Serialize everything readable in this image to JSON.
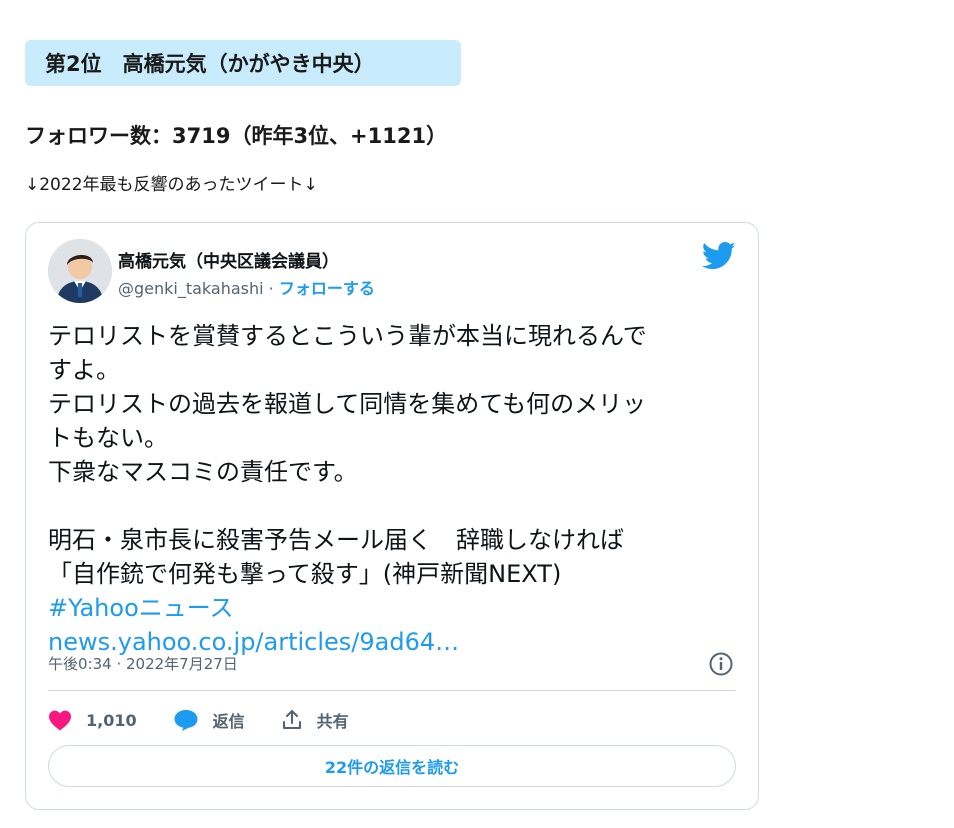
{
  "rank": {
    "label": "第2位　高橋元気（かがやき中央）"
  },
  "followers": {
    "text": "フォロワー数：3719（昨年3位、+1121）"
  },
  "note": {
    "text": "↓2022年最も反響のあったツイート↓"
  },
  "tweet": {
    "author_name": "高橋元気（中央区議会議員）",
    "handle": "@genki_takahashi",
    "separator": " · ",
    "follow_label": "フォローする",
    "body": {
      "line1": "テロリストを賞賛するとこういう輩が本当に現れるんで",
      "line2": "すよ。",
      "line3": "テロリストの過去を報道して同情を集めても何のメリッ",
      "line4": "トもない。",
      "line5": "下衆なマスコミの責任です。",
      "line6": "明石・泉市長に殺害予告メール届く　辞職しなければ",
      "line7": "「自作銃で何発も撃って殺す」(神戸新聞NEXT)",
      "hashtag": "#Yahooニュース",
      "link": "news.yahoo.co.jp/articles/9ad64…"
    },
    "timestamp": "午後0:34 · 2022年7月27日",
    "like_count": "1,010",
    "reply_label": "返信",
    "share_label": "共有",
    "read_replies_label": "22件の返信を読む"
  },
  "colors": {
    "accent": "#1d9bf0",
    "badge_bg": "#c8ecfb",
    "like": "#f91880",
    "muted": "#536471"
  },
  "icons": [
    "twitter-bird-icon",
    "info-icon",
    "heart-icon",
    "reply-bubble-icon",
    "share-icon"
  ]
}
